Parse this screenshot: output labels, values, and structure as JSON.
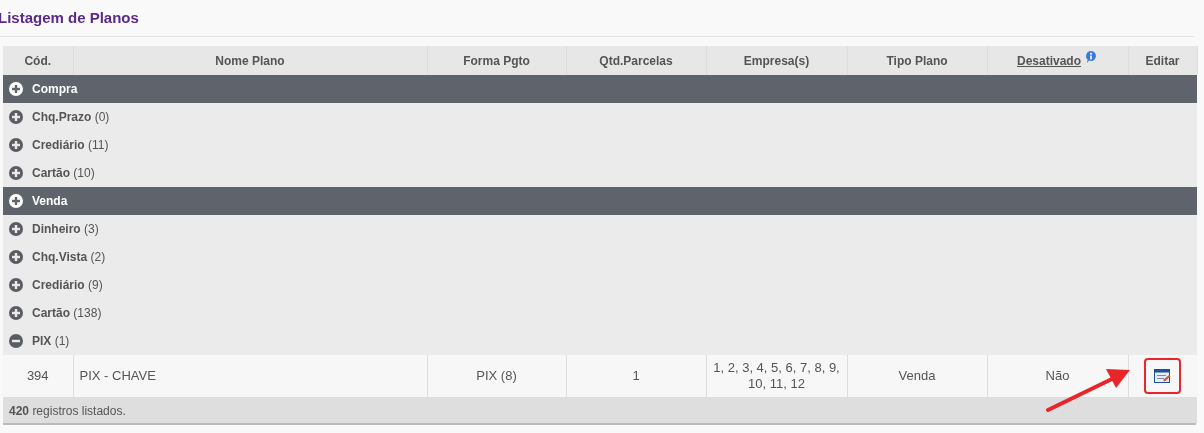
{
  "title": "Listagem de Planos",
  "columns": [
    {
      "label": "Cód.",
      "link": false,
      "info": false
    },
    {
      "label": "Nome Plano",
      "link": false,
      "info": false
    },
    {
      "label": "Forma Pgto",
      "link": false,
      "info": false
    },
    {
      "label": "Qtd.Parcelas",
      "link": false,
      "info": false
    },
    {
      "label": "Empresa(s)",
      "link": false,
      "info": false
    },
    {
      "label": "Tipo Plano",
      "link": false,
      "info": false
    },
    {
      "label": "Desativado",
      "link": true,
      "info": true
    },
    {
      "label": "Editar",
      "link": false,
      "info": false
    }
  ],
  "groups": [
    {
      "label": "Compra",
      "expanded": false,
      "children": [
        {
          "name": "Chq.Prazo",
          "count": "(0)",
          "expanded": false
        },
        {
          "name": "Crediário",
          "count": "(11)",
          "expanded": false
        },
        {
          "name": "Cartão",
          "count": "(10)",
          "expanded": false
        }
      ]
    },
    {
      "label": "Venda",
      "expanded": false,
      "children": [
        {
          "name": "Dinheiro",
          "count": "(3)",
          "expanded": false
        },
        {
          "name": "Chq.Vista",
          "count": "(2)",
          "expanded": false
        },
        {
          "name": "Crediário",
          "count": "(9)",
          "expanded": false
        },
        {
          "name": "Cartão",
          "count": "(138)",
          "expanded": false
        },
        {
          "name": "PIX",
          "count": "(1)",
          "expanded": true,
          "rows": [
            {
              "code": "394",
              "name": "PIX - CHAVE",
              "payment": "PIX (8)",
              "installments": "1",
              "companies": "1, 2, 3, 4, 5, 6, 7, 8, 9, 10, 11, 12",
              "type": "Venda",
              "disabled": "Não",
              "highlighted": true
            }
          ]
        }
      ]
    }
  ],
  "footer": {
    "count": "420",
    "text": "registros listados."
  }
}
